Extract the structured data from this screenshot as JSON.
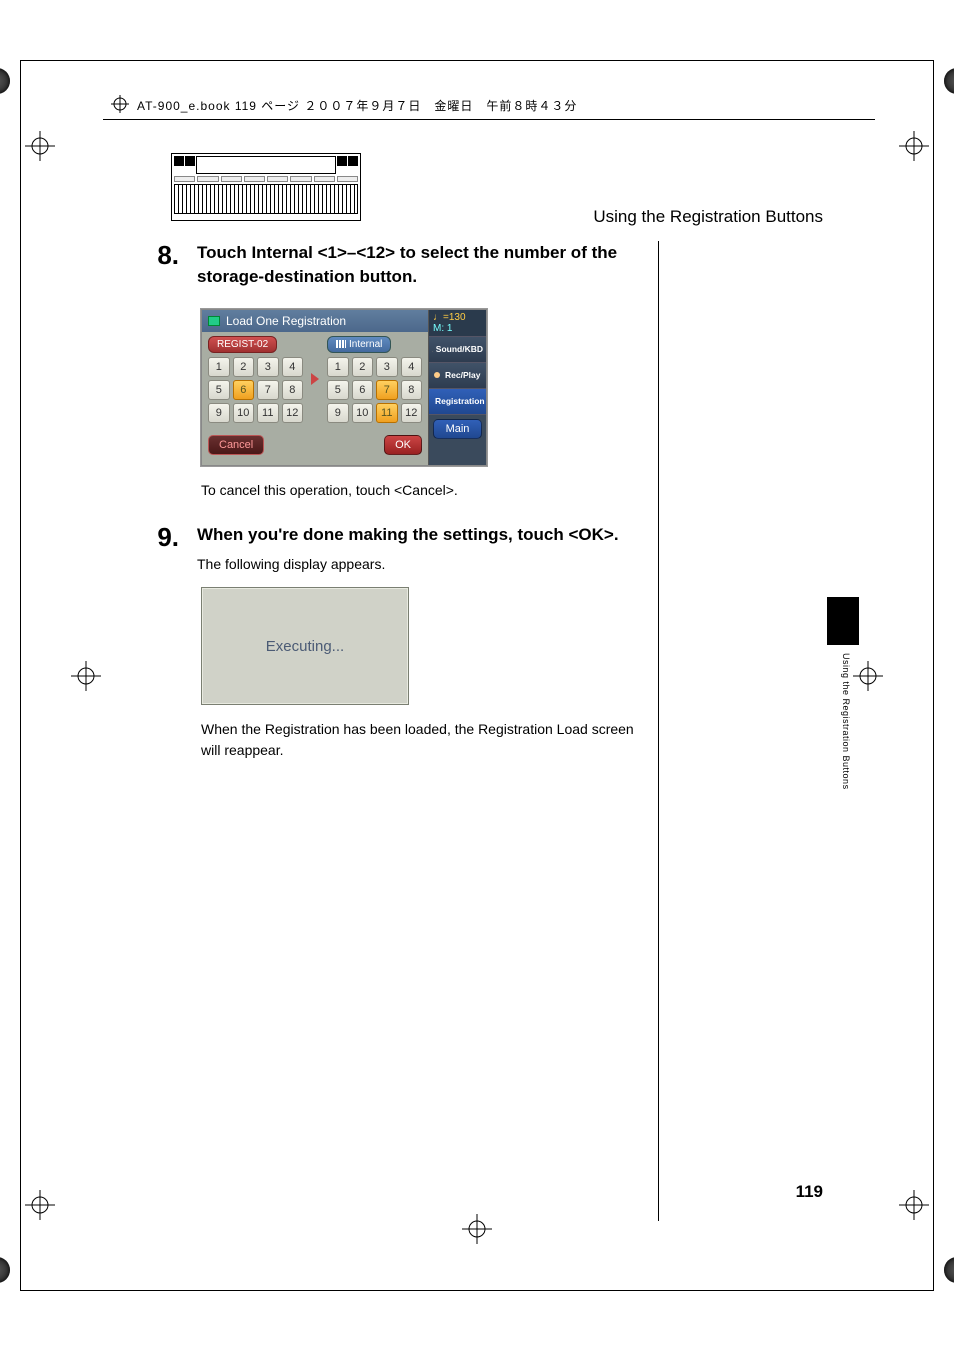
{
  "header": {
    "book_line": "AT-900_e.book  119 ページ  ２００７年９月７日　金曜日　午前８時４３分"
  },
  "section_title": "Using the Registration Buttons",
  "side_tab_label": "Using the Registration Buttons",
  "step8": {
    "num": "8.",
    "heading": "Touch Internal <1>–<12> to select the number of the storage-destination button.",
    "cancel_note": "To cancel this operation, touch <Cancel>."
  },
  "screenshot": {
    "title": "Load One Registration",
    "tempo_top": "♩=130",
    "tempo_bottom": "M:      1",
    "left_label": "REGIST-02",
    "right_label": "Internal",
    "left_grid": [
      "1",
      "2",
      "3",
      "4",
      "5",
      "6",
      "7",
      "8",
      "9",
      "10",
      "11",
      "12"
    ],
    "left_selected": [
      5
    ],
    "right_grid": [
      "1",
      "2",
      "3",
      "4",
      "5",
      "6",
      "7",
      "8",
      "9",
      "10",
      "11",
      "12"
    ],
    "right_selected": [
      6,
      10
    ],
    "side_buttons": [
      {
        "label": "Sound/KBD",
        "active": false,
        "icon": "note-icon"
      },
      {
        "label": "Rec/Play",
        "active": false,
        "icon": "speaker-icon"
      },
      {
        "label": "Registration",
        "active": true,
        "icon": "disk-icon"
      }
    ],
    "cancel": "Cancel",
    "ok": "OK",
    "main": "Main"
  },
  "step9": {
    "num": "9.",
    "heading": "When you're done making the settings, touch <OK>.",
    "text1": "The following display appears.",
    "exec": "Executing...",
    "text2": "When the Registration has been loaded, the Registration Load screen will reappear."
  },
  "page_number": "119"
}
